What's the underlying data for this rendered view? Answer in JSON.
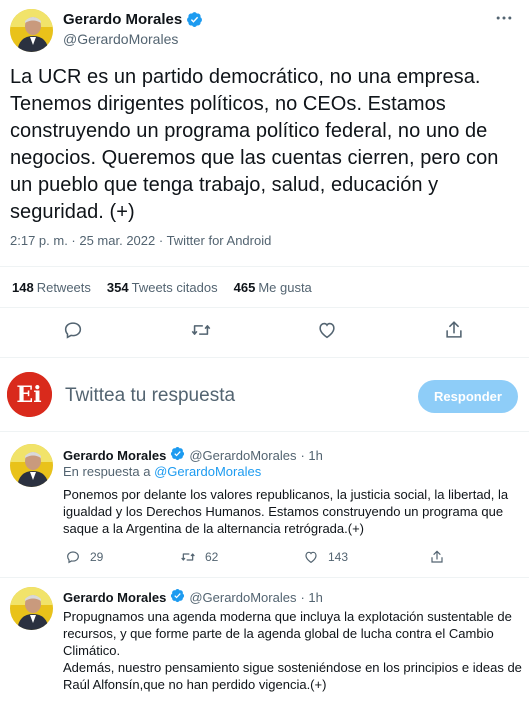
{
  "main_tweet": {
    "name": "Gerardo Morales",
    "handle": "@GerardoMorales",
    "text": "La UCR es un partido democrático, no una empresa. Tenemos dirigentes políticos, no CEOs. Estamos construyendo un programa político federal, no uno de negocios. Queremos que las cuentas cierren, pero con un pueblo que tenga trabajo, salud, educación y seguridad. (+)",
    "meta": "2:17 p. m. · 25 mar. 2022 · Twitter for Android",
    "stats": {
      "retweets_count": "148",
      "retweets_label": "Retweets",
      "quotes_count": "354",
      "quotes_label": "Tweets citados",
      "likes_count": "465",
      "likes_label": "Me gusta"
    }
  },
  "composer": {
    "placeholder": "Twittea tu respuesta",
    "button_label": "Responder",
    "avatar_text": "Ei"
  },
  "replies": [
    {
      "name": "Gerardo Morales",
      "handle": "@GerardoMorales",
      "time": "· 1h",
      "reply_to_prefix": "En respuesta a",
      "reply_to_handle": "@GerardoMorales",
      "text": "Ponemos por delante los valores republicanos, la justicia social, la libertad, la igualdad y los Derechos Humanos. Estamos construyendo un programa que saque a la Argentina de la alternancia retrógrada.(+)",
      "replies_count": "29",
      "retweets_count": "62",
      "likes_count": "143"
    },
    {
      "name": "Gerardo Morales",
      "handle": "@GerardoMorales",
      "time": "· 1h",
      "text_lines": [
        "Propugnamos una agenda moderna que incluya la explotación sustentable de recursos, y que forme parte de la agenda global de lucha contra el Cambio Climático.",
        "Además, nuestro pensamiento sigue sosteniéndose en los principios e ideas de Raúl Alfonsín,que no han perdido vigencia.(+)"
      ]
    }
  ],
  "colors": {
    "accent": "#1d9bf0",
    "reply_button": "#8ecdf8",
    "secondary_text": "#536471",
    "composer_avatar": "#d92a1c"
  },
  "icons": [
    "verified-badge-icon",
    "more-icon",
    "reply-icon",
    "retweet-icon",
    "like-icon",
    "share-icon"
  ]
}
